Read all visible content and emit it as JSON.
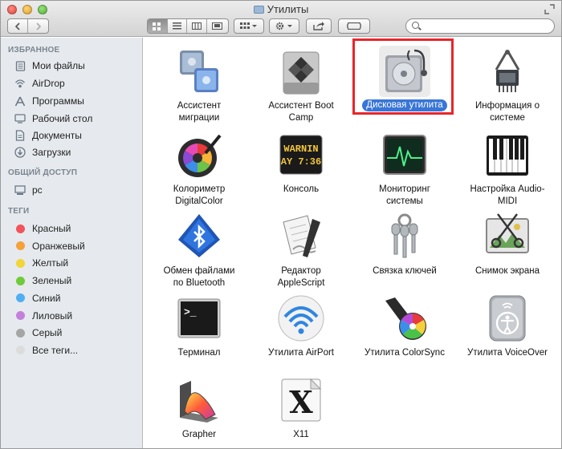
{
  "window": {
    "title": "Утилиты"
  },
  "toolbar": {
    "search_placeholder": ""
  },
  "sidebar": {
    "favorites_header": "ИЗБРАННОЕ",
    "favorites": [
      {
        "label": "Мои файлы",
        "icon": "all-my-files-icon"
      },
      {
        "label": "AirDrop",
        "icon": "airdrop-icon"
      },
      {
        "label": "Программы",
        "icon": "applications-icon"
      },
      {
        "label": "Рабочий стол",
        "icon": "desktop-icon"
      },
      {
        "label": "Документы",
        "icon": "documents-icon"
      },
      {
        "label": "Загрузки",
        "icon": "downloads-icon"
      }
    ],
    "shared_header": "ОБЩИЙ ДОСТУП",
    "shared": [
      {
        "label": "pc",
        "icon": "computer-icon"
      }
    ],
    "tags_header": "ТЕГИ",
    "tags": [
      {
        "label": "Красный",
        "color": "#f2545b"
      },
      {
        "label": "Оранжевый",
        "color": "#f6a03a"
      },
      {
        "label": "Желтый",
        "color": "#f2d536"
      },
      {
        "label": "Зеленый",
        "color": "#6fcb3a"
      },
      {
        "label": "Синий",
        "color": "#52aef3"
      },
      {
        "label": "Лиловый",
        "color": "#c47fdb"
      },
      {
        "label": "Серый",
        "color": "#a5a5a5"
      },
      {
        "label": "Все теги...",
        "color": "#dcdcdc"
      }
    ]
  },
  "apps": [
    {
      "line1": "Ассистент",
      "line2": "миграции",
      "icon": "migration-assistant-icon"
    },
    {
      "line1": "Ассистент Boot",
      "line2": "Camp",
      "icon": "boot-camp-icon"
    },
    {
      "line1": "Дисковая утилита",
      "line2": "",
      "icon": "disk-utility-icon",
      "selected": true
    },
    {
      "line1": "Информация о",
      "line2": "системе",
      "icon": "system-information-icon"
    },
    {
      "line1": "Колориметр",
      "line2": "DigitalColor",
      "icon": "digital-color-meter-icon"
    },
    {
      "line1": "Консоль",
      "line2": "",
      "icon": "console-icon",
      "console_text": "WARNIN",
      "console_text2": "AY 7:36"
    },
    {
      "line1": "Мониторинг",
      "line2": "системы",
      "icon": "activity-monitor-icon"
    },
    {
      "line1": "Настройка Audio-",
      "line2": "MIDI",
      "icon": "audio-midi-icon"
    },
    {
      "line1": "Обмен файлами",
      "line2": "по Bluetooth",
      "icon": "bluetooth-exchange-icon"
    },
    {
      "line1": "Редактор",
      "line2": "AppleScript",
      "icon": "applescript-editor-icon"
    },
    {
      "line1": "Связка ключей",
      "line2": "",
      "icon": "keychain-icon"
    },
    {
      "line1": "Снимок экрана",
      "line2": "",
      "icon": "grab-icon"
    },
    {
      "line1": "Терминал",
      "line2": "",
      "icon": "terminal-icon",
      "prompt": ">_"
    },
    {
      "line1": "Утилита AirPort",
      "line2": "",
      "icon": "airport-utility-icon"
    },
    {
      "line1": "Утилита ColorSync",
      "line2": "",
      "icon": "colorsync-icon"
    },
    {
      "line1": "Утилита VoiceOver",
      "line2": "",
      "icon": "voiceover-icon"
    },
    {
      "line1": "Grapher",
      "line2": "",
      "icon": "grapher-icon"
    },
    {
      "line1": "X11",
      "line2": "",
      "icon": "x11-icon",
      "glyph": "X"
    }
  ],
  "colors": {
    "selection": "#3875d7",
    "highlight_box": "#e8252b",
    "sidebar_bg": "#e6eaee"
  }
}
